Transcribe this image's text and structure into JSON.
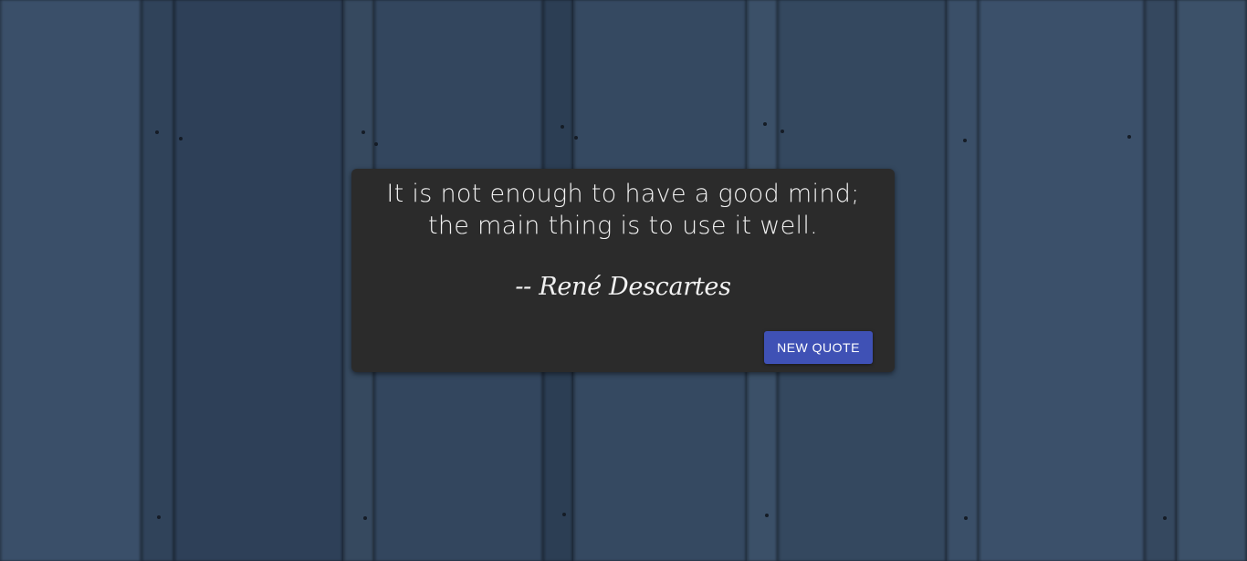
{
  "quote": {
    "text_line1": "It is not enough to have a good mind;",
    "text_line2": "the main thing is to use it well.",
    "author": "-- René Descartes"
  },
  "actions": {
    "new_quote_label": "NEW QUOTE"
  },
  "colors": {
    "background": "#34465f",
    "card": "#2b2b2b",
    "text": "#f2f2f2",
    "button": "#3f51b5"
  }
}
